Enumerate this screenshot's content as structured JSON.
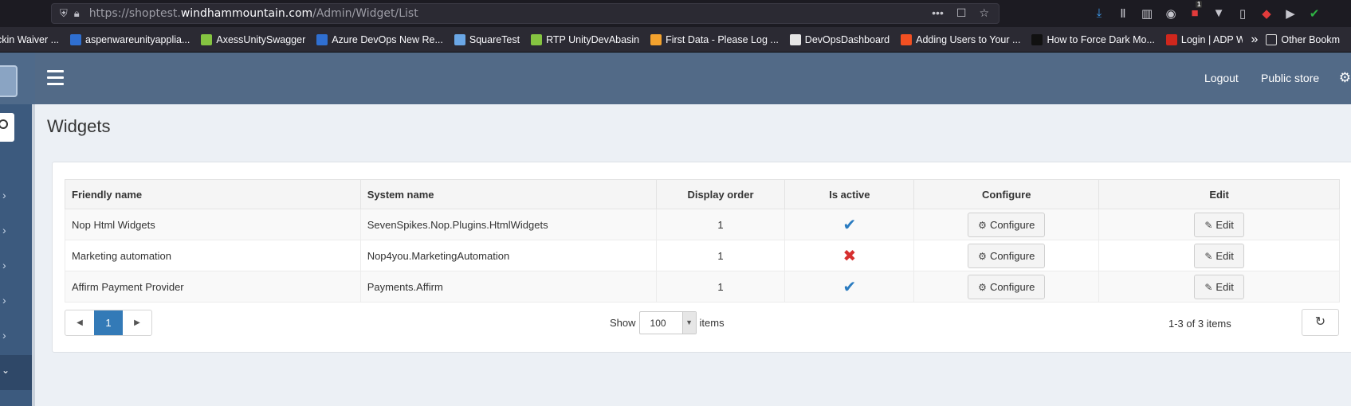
{
  "browser": {
    "url_prefix": "https://shoptest.",
    "url_domain": "windhammountain.com",
    "url_path": "/Admin/Widget/List",
    "badge_count": "1"
  },
  "bookmarks": [
    {
      "label": "ckin Waiver ...",
      "color": "#2b2a33"
    },
    {
      "label": "aspenwareunityapplia...",
      "color": "#2f6fd1"
    },
    {
      "label": "AxessUnitySwagger",
      "color": "#85c441"
    },
    {
      "label": "Azure DevOps New Re...",
      "color": "#2f6fd1"
    },
    {
      "label": "SquareTest",
      "color": "#6aa7e6"
    },
    {
      "label": "RTP UnityDevAbasin",
      "color": "#85c441"
    },
    {
      "label": "First Data - Please Log ...",
      "color": "#f3a22e"
    },
    {
      "label": "DevOpsDashboard",
      "color": "#e6e6e6"
    },
    {
      "label": "Adding Users to Your ...",
      "color": "#f25022"
    },
    {
      "label": "How to Force Dark Mo...",
      "color": "#111111"
    },
    {
      "label": "Login | ADP Workforc...",
      "color": "#d0271d"
    }
  ],
  "bookmarks_other": "Other Bookm",
  "header": {
    "logout": "Logout",
    "public_store": "Public store"
  },
  "page": {
    "title": "Widgets"
  },
  "table": {
    "columns": [
      "Friendly name",
      "System name",
      "Display order",
      "Is active",
      "Configure",
      "Edit"
    ],
    "rows": [
      {
        "friendly_name": "Nop Html Widgets",
        "system_name": "SevenSpikes.Nop.Plugins.HtmlWidgets",
        "display_order": "1",
        "is_active": true
      },
      {
        "friendly_name": "Marketing automation",
        "system_name": "Nop4you.MarketingAutomation",
        "display_order": "1",
        "is_active": false
      },
      {
        "friendly_name": "Affirm Payment Provider",
        "system_name": "Payments.Affirm",
        "display_order": "1",
        "is_active": true
      }
    ],
    "configure_label": "Configure",
    "edit_label": "Edit"
  },
  "pager": {
    "current_page": "1",
    "show_label": "Show",
    "page_size": "100",
    "items_label": "items",
    "summary": "1-3 of 3 items"
  }
}
